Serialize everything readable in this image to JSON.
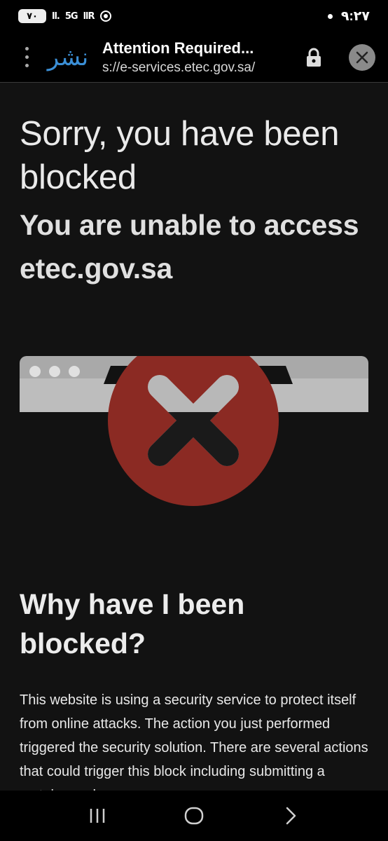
{
  "status_bar": {
    "battery": "٧٠",
    "signal1": "ll.",
    "network": "5G",
    "signal2": "llR",
    "time": "٩:٢٧"
  },
  "toolbar": {
    "logo_text": "نشر",
    "title": "Attention Required...",
    "url": "s://e-services.etec.gov.sa/"
  },
  "content": {
    "heading": "Sorry, you have been blocked",
    "subheading": "You are unable to access etec.gov.sa",
    "why_heading": "Why have I been blocked?",
    "why_body": "This website is using a security service to protect itself from online attacks. The action you just performed triggered the security solution. There are several actions that could trigger this block including submitting a certain word or"
  },
  "colors": {
    "accent_red": "#8b2a23",
    "browser_bar": "#a8a8a8",
    "logo_blue": "#3b8fd6"
  },
  "icons": {
    "menu": "more-vertical-icon",
    "lock": "lock-icon",
    "close": "close-icon",
    "nav_recent": "recent-apps-icon",
    "nav_home": "home-icon",
    "nav_back": "back-icon"
  }
}
